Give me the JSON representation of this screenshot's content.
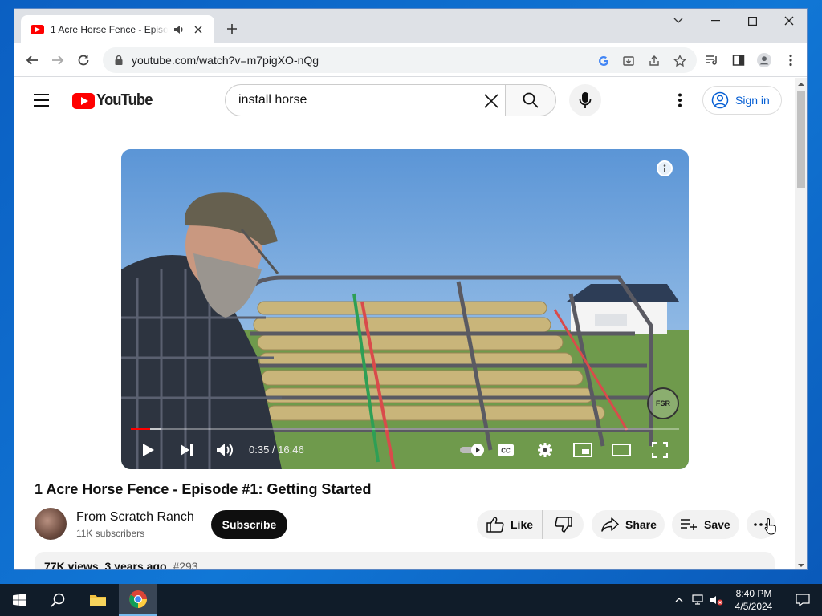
{
  "browser": {
    "tab_title": "1 Acre Horse Fence - Episode #1: Getting Started",
    "url": "youtube.com/watch?v=m7pigXO-nQg"
  },
  "youtube": {
    "logo_text": "YouTube",
    "search_value": "install horse",
    "sign_in_label": "Sign in",
    "video": {
      "timecode": "0:35 / 16:46",
      "progress_played_pct": 3.5,
      "progress_loaded_pct": 5.5,
      "watermark_text": "FSR"
    },
    "title": "1 Acre Horse Fence - Episode #1: Getting Started",
    "channel": {
      "name": "From Scratch Ranch",
      "subscribers": "11K subscribers",
      "subscribe_label": "Subscribe"
    },
    "actions": {
      "like_label": "Like",
      "share_label": "Share",
      "save_label": "Save"
    },
    "description": {
      "views": "77K views",
      "age": "3 years ago",
      "tag": "#293"
    }
  },
  "taskbar": {
    "time": "8:40 PM",
    "date": "4/5/2024"
  },
  "colors": {
    "accent": "#065fd4",
    "brand": "#ff0000",
    "taskbar": "#101c29"
  }
}
